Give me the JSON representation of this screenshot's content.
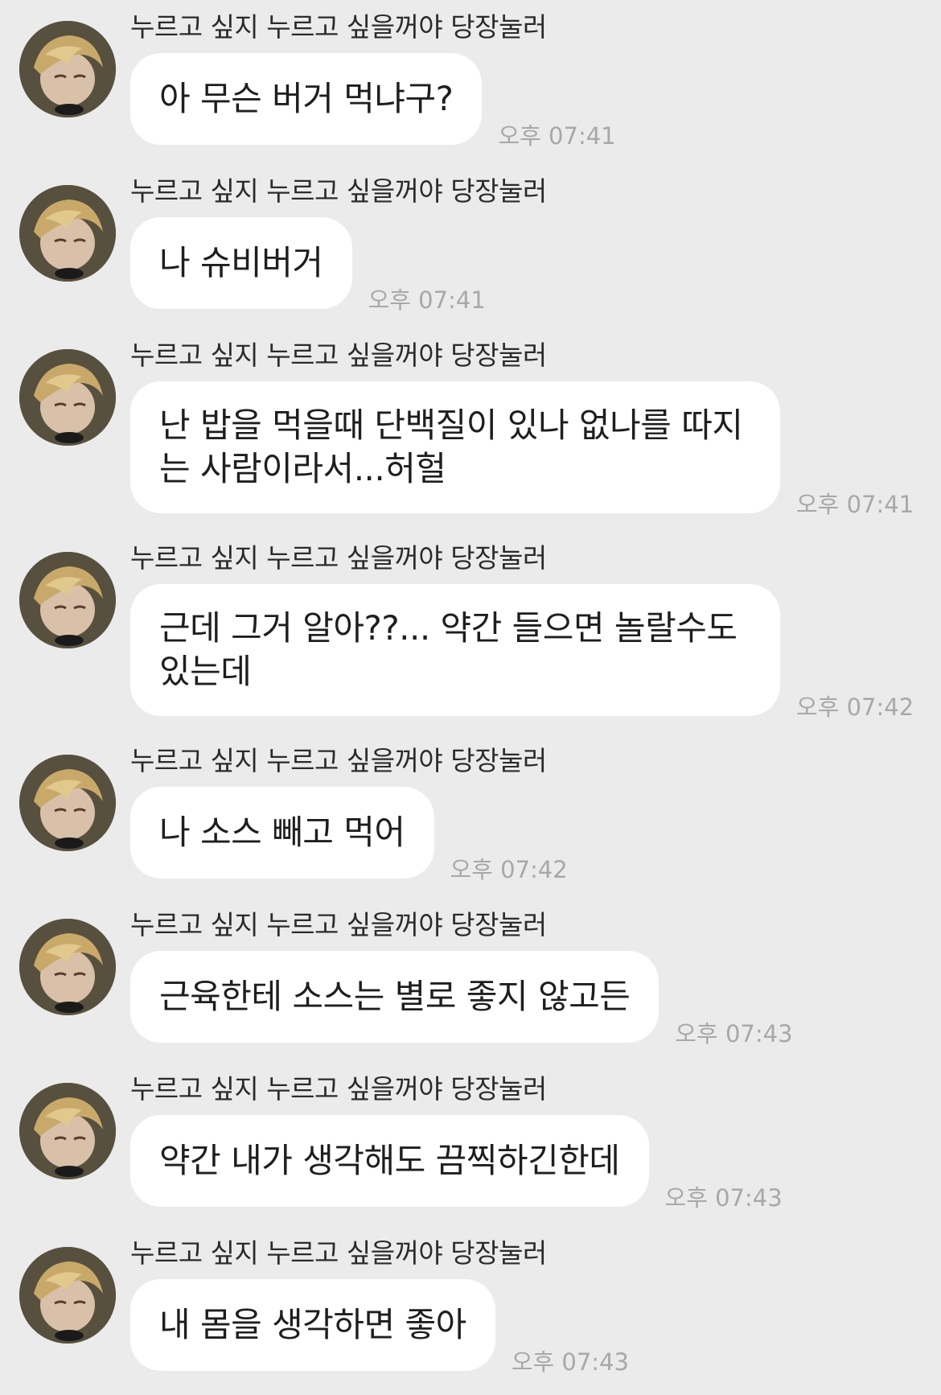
{
  "sender_name": "누르고 싶지 누르고 싶을꺼야 당장눌러",
  "messages": [
    {
      "text": "아 무슨 버거 먹냐구?",
      "time": "오후 07:41"
    },
    {
      "text": "나 슈비버거",
      "time": "오후 07:41"
    },
    {
      "text": "난 밥을 먹을때 단백질이 있나 없나를 따지는 사람이라서...허헐",
      "time": "오후 07:41"
    },
    {
      "text": "근데 그거 알아??... 약간 들으면 놀랄수도 있는데",
      "time": "오후 07:42"
    },
    {
      "text": "나 소스 빼고 먹어",
      "time": "오후 07:42"
    },
    {
      "text": "근육한테 소스는 별로 좋지 않고든",
      "time": "오후 07:43"
    },
    {
      "text": "약간 내가 생각해도 끔찍하긴한데",
      "time": "오후 07:43"
    },
    {
      "text": "내 몸을 생각하면 좋아",
      "time": "오후 07:43"
    }
  ],
  "icons": {
    "avatar": "profile-photo-icon"
  },
  "colors": {
    "background": "#ebebeb",
    "bubble": "#ffffff",
    "timestamp": "#a8a8a8"
  }
}
